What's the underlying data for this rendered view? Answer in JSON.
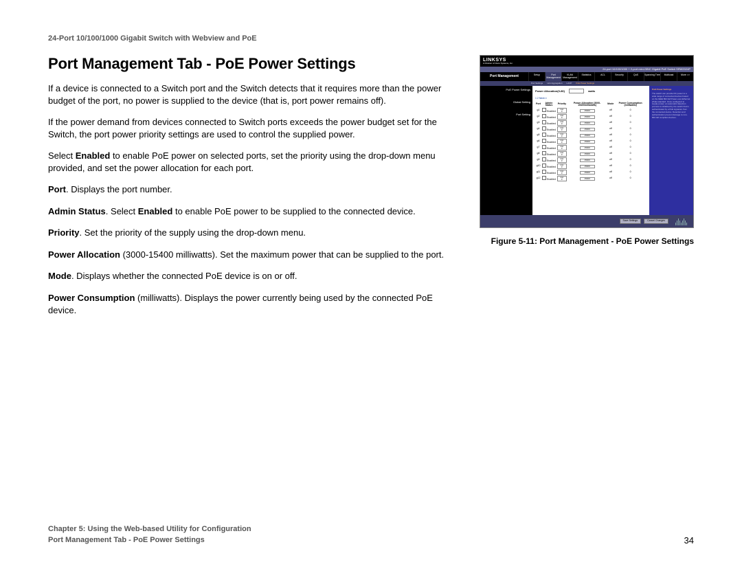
{
  "header": {
    "product": "24-Port 10/100/1000 Gigabit Switch with Webview and PoE"
  },
  "title": "Port Management Tab - PoE Power Settings",
  "paragraphs": {
    "p1": "If a device is connected to a Switch port and the Switch detects that it requires more than the power budget of the port, no power is supplied to the device (that is, port power remains off).",
    "p2": "If the power demand from devices connected to Switch ports exceeds the power budget set for the Switch, the port power priority settings are used to control the supplied power.",
    "p3a": "Select ",
    "p3b": "Enabled",
    "p3c": " to enable PoE power on selected ports, set the priority using the drop-down menu provided, and set the power allocation for each port.",
    "p4a": "Port",
    "p4b": ". Displays the port number.",
    "p5a": "Admin Status",
    "p5b": ". Select ",
    "p5c": "Enabled",
    "p5d": " to enable PoE power to be supplied to the connected device.",
    "p6a": "Priority",
    "p6b": ". Set the priority of the supply using the drop-down menu.",
    "p7a": "Power Allocation",
    "p7b": " (3000-15400 milliwatts). Set the maximum power that can be supplied to the port.",
    "p8a": "Mode",
    "p8b": ". Displays whether the connected PoE device is on or off.",
    "p9a": "Power Consumption",
    "p9b": " (milliwatts). Displays the power currently being used by the connected PoE device."
  },
  "figure": {
    "brand": "LINKSYS",
    "brand_sub": "A Division of Cisco Systems, Inc.",
    "titlebar": "24-port 10/100/1000 + 2-port mini-GBIC Gigabit PoE Switch    SRW2024P",
    "nav_section": "Port Management",
    "tabs": [
      "Setup",
      "Port Management",
      "VLAN Management",
      "Statistics",
      "ACL",
      "Security",
      "QoS",
      "Spanning Tree",
      "Multicast",
      "More >>"
    ],
    "subnav": [
      "Port Settings",
      "Link Aggregation",
      "LACP",
      "PoE Power Settings"
    ],
    "side_labels": [
      "PoE Power Settings",
      "Global Setting",
      "Port Setting"
    ],
    "alloc_label": "Power Allocation(0-80)",
    "alloc_unit": "watts",
    "pager": "1 2  Next>>",
    "table": {
      "headers": [
        "Port",
        "Admin Status",
        "Priority",
        "Power Allocation (3000-15400milliwatts)",
        "Mode",
        "Power Consumption (milliwatts)"
      ],
      "rows": [
        {
          "port": "g1",
          "status": "Enabled",
          "priority": "low",
          "alloc": "15400",
          "mode": "off",
          "cons": "0"
        },
        {
          "port": "g2",
          "status": "Enabled",
          "priority": "low",
          "alloc": "15400",
          "mode": "off",
          "cons": "0"
        },
        {
          "port": "g3",
          "status": "Enabled",
          "priority": "low",
          "alloc": "15400",
          "mode": "off",
          "cons": "0"
        },
        {
          "port": "g4",
          "status": "Enabled",
          "priority": "low",
          "alloc": "15400",
          "mode": "off",
          "cons": "0"
        },
        {
          "port": "g5",
          "status": "Enabled",
          "priority": "low",
          "alloc": "15400",
          "mode": "off",
          "cons": "0"
        },
        {
          "port": "g6",
          "status": "Enabled",
          "priority": "low",
          "alloc": "15400",
          "mode": "off",
          "cons": "0"
        },
        {
          "port": "g7",
          "status": "Enabled",
          "priority": "low",
          "alloc": "15400",
          "mode": "off",
          "cons": "0"
        },
        {
          "port": "g8",
          "status": "Enabled",
          "priority": "low",
          "alloc": "15400",
          "mode": "off",
          "cons": "0"
        },
        {
          "port": "g9",
          "status": "Enabled",
          "priority": "low",
          "alloc": "15400",
          "mode": "off",
          "cons": "0"
        },
        {
          "port": "g10",
          "status": "Enabled",
          "priority": "low",
          "alloc": "15400",
          "mode": "off",
          "cons": "0"
        },
        {
          "port": "g11",
          "status": "Enabled",
          "priority": "low",
          "alloc": "15400",
          "mode": "off",
          "cons": "0"
        },
        {
          "port": "g12",
          "status": "Enabled",
          "priority": "low",
          "alloc": "15400",
          "mode": "off",
          "cons": "0"
        }
      ]
    },
    "right_title": "PoE Power Settings",
    "right_text": "The switch can provide DC power to a wide range of connected devices based on the IEEE 802.3af Power-over-Ethernet (PoE) standard. Once configured to supply power, an automatic detection process is initialized by the switch that is authenticated by a PoE signature from the connected device. Detection and authentication prevent damage to non-802.3af compliant devices.",
    "buttons": [
      "Save Settings",
      "Cancel Changes"
    ],
    "caption": "Figure 5-11: Port Management - PoE Power Settings"
  },
  "footer": {
    "chapter": "Chapter 5: Using the Web-based Utility for Configuration",
    "section": "Port Management Tab - PoE Power Settings",
    "page": "34"
  }
}
